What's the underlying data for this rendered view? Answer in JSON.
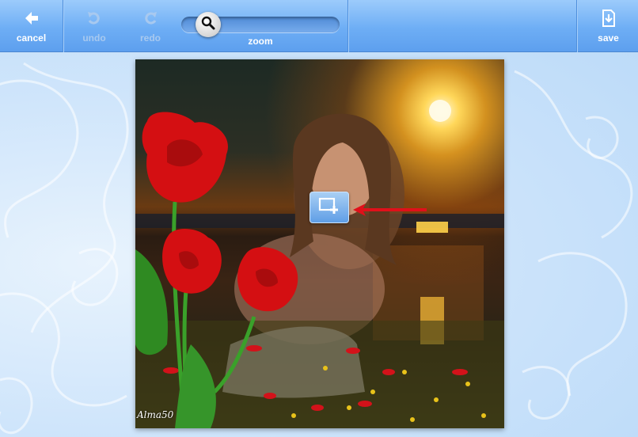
{
  "toolbar": {
    "cancel_label": "cancel",
    "undo_label": "undo",
    "redo_label": "redo",
    "zoom_label": "zoom",
    "save_label": "save",
    "zoom_level_fraction": 0.0,
    "undo_enabled": false,
    "redo_enabled": false
  },
  "photo": {
    "watermark": "Alma50"
  },
  "icons": {
    "cancel": "arrow-left-icon",
    "undo": "undo-icon",
    "redo": "redo-icon",
    "zoom": "magnifier-icon",
    "save": "save-download-icon",
    "crop": "crop-add-icon",
    "pointer": "red-arrow-icon"
  },
  "colors": {
    "toolbar": "#6eaef5",
    "toolbar_text": "#ffffff",
    "disabled_text": "#a8c9ef",
    "arrow": "#e0101a"
  }
}
